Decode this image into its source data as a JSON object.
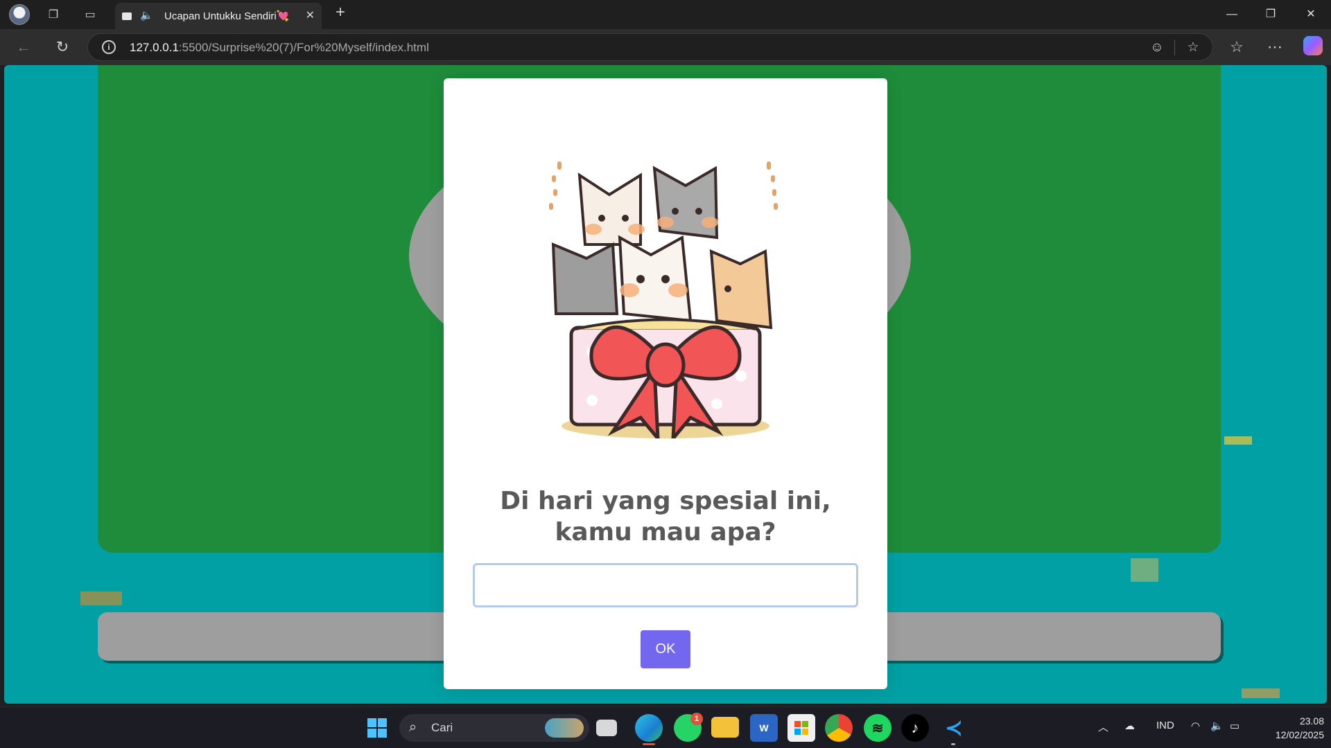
{
  "browser": {
    "tab_title": "Ucapan Untukku Sendiri💘",
    "url_host": "127.0.0.1",
    "url_path": ":5500/Surprise%20(7)/For%20Myself/index.html"
  },
  "modal": {
    "image_alt": "Cute cats in a gift box with a red bow",
    "title_line1": "Di hari yang spesial ini,",
    "title_line2": "kamu mau apa?",
    "input_value": "",
    "ok_label": "OK"
  },
  "taskbar": {
    "search_placeholder": "Cari",
    "whatsapp_badge": "1",
    "language": "IND",
    "time": "23.08",
    "date": "12/02/2025"
  },
  "colors": {
    "page_background": "#00a0a4",
    "card_green": "#1e8c3b",
    "ok_button": "#7367f0",
    "title_text": "#595959"
  }
}
